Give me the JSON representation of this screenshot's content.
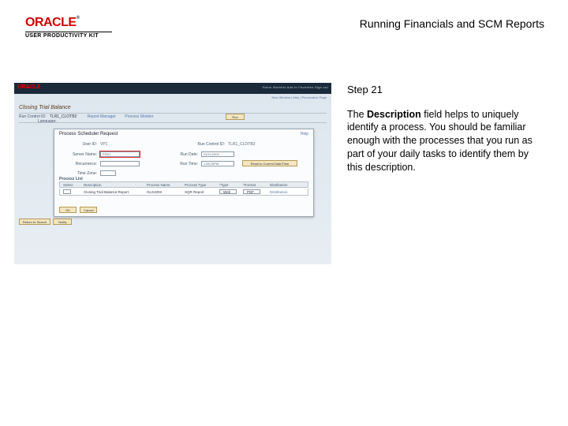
{
  "header": {
    "brand_primary": "ORACLE",
    "brand_tm": "®",
    "brand_secondary": "USER PRODUCTIVITY KIT",
    "title": "Running Financials and SCM Reports"
  },
  "step": {
    "label": "Step 21",
    "paragraph_pre": "The ",
    "paragraph_bold": "Description",
    "paragraph_post": " field helps to uniquely identify a process. You should be familiar enough with the processes that you run as part of your daily tasks to identify them by this description."
  },
  "shot": {
    "brand": "ORACLE",
    "nav": "Home   Worklist   Add to Favorites   Sign out",
    "crumb": "New Window | Help | Personalize Page",
    "page_title": "Closing Trial Balance",
    "run_control_label": "Run Control ID:",
    "run_control_value": "TLR1_CLOTB2",
    "report_manager": "Report Manager",
    "process_monitor": "Process Monitor",
    "run_btn": "Run",
    "language_label": "Language:",
    "left_btn1": "Return to Search",
    "left_btn2": "Notify",
    "modal": {
      "title": "Process Scheduler Request",
      "help": "Help",
      "user_id_label": "User ID:",
      "user_id_value": "VP1",
      "run_cntl_label": "Run Control ID:",
      "run_cntl_value": "TLR1_CLOTB2",
      "server_label": "Server Name:",
      "server_value": "PSNT",
      "run_date_label": "Run Date:",
      "run_date_value": "03/11/2009",
      "recurrence_label": "Recurrence:",
      "run_time_label": "Run Time:",
      "run_time_value": "1:55:25PM",
      "reset_btn": "Reset to Current Date/Time",
      "time_zone_label": "Time Zone:",
      "list_heading": "Process List",
      "th_select": "Select",
      "th_desc": "Description",
      "th_name": "Process Name",
      "th_type": "Process Type",
      "th_ptype": "*Type",
      "th_format": "*Format",
      "th_dist": "Distribution",
      "row_desc": "Closing Trial Balance Report",
      "row_name": "GLS1003",
      "row_type": "SQR Report",
      "row_ptype": "Web",
      "row_format": "PDF",
      "row_dist": "Distribution",
      "ok": "OK",
      "cancel": "Cancel"
    }
  }
}
